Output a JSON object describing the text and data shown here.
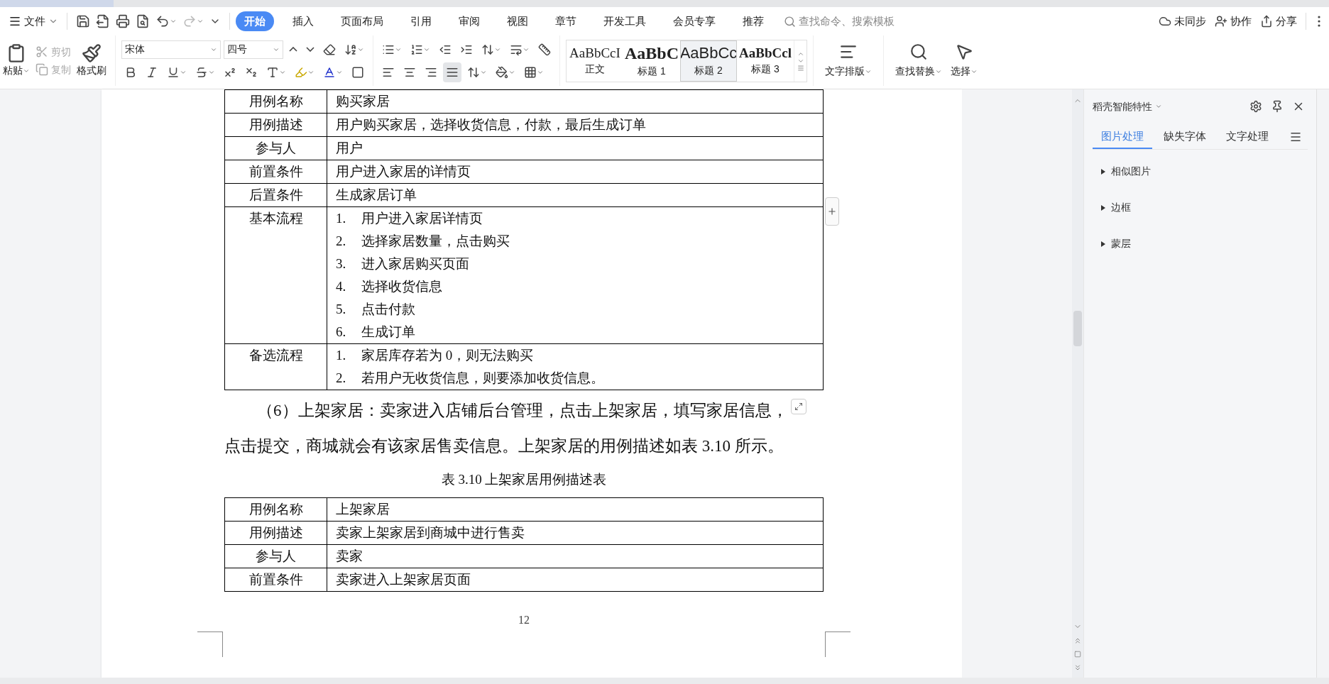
{
  "menu": {
    "file": "文件",
    "tabs": [
      {
        "label": "开始",
        "selected": true
      },
      {
        "label": "插入",
        "selected": false
      },
      {
        "label": "页面布局",
        "selected": false
      },
      {
        "label": "引用",
        "selected": false
      },
      {
        "label": "审阅",
        "selected": false
      },
      {
        "label": "视图",
        "selected": false
      },
      {
        "label": "章节",
        "selected": false
      },
      {
        "label": "开发工具",
        "selected": false
      },
      {
        "label": "会员专享",
        "selected": false
      },
      {
        "label": "推荐",
        "selected": false
      }
    ],
    "search": {
      "placeholder": "查找命令、搜索模板"
    },
    "actions": [
      "未同步",
      "协作",
      "分享"
    ]
  },
  "ribbon": {
    "paste": "粘贴",
    "cut": {
      "label": "剪切",
      "disabled": true
    },
    "copy": {
      "label": "复制",
      "disabled": true
    },
    "format_painter": "格式刷",
    "font": {
      "name": "宋体",
      "size": "四号"
    },
    "styles": [
      {
        "preview": "AaBbCcI",
        "label": "正文",
        "selected": false,
        "kind": "body"
      },
      {
        "preview": "AaBbC",
        "label": "标题 1",
        "selected": false,
        "kind": "h1"
      },
      {
        "preview": "AaBbCc",
        "label": "标题 2",
        "selected": true,
        "kind": "h2"
      },
      {
        "preview": "AaBbCcl",
        "label": "标题 3",
        "selected": false,
        "kind": "h3"
      }
    ],
    "text_layout": "文字排版",
    "find_replace": "查找替换",
    "select": "选择"
  },
  "document": {
    "table_1": [
      {
        "label": "用例名称",
        "lines": [
          {
            "text": "购买家居"
          }
        ]
      },
      {
        "label": "用例描述",
        "lines": [
          {
            "text": "用户购买家居，选择收货信息，付款，最后生成订单"
          }
        ]
      },
      {
        "label": "参与人",
        "lines": [
          {
            "text": "用户"
          }
        ]
      },
      {
        "label": "前置条件",
        "lines": [
          {
            "text": "用户进入家居的详情页"
          }
        ]
      },
      {
        "label": "后置条件",
        "lines": [
          {
            "text": "生成家居订单"
          }
        ]
      },
      {
        "label": "基本流程",
        "lines": [
          {
            "num": "1.",
            "text": "用户进入家居详情页"
          },
          {
            "num": "2.",
            "text": "选择家居数量，点击购买"
          },
          {
            "num": "3.",
            "text": "进入家居购买页面"
          },
          {
            "num": "4.",
            "text": "选择收货信息"
          },
          {
            "num": "5.",
            "text": "点击付款"
          },
          {
            "num": "6.",
            "text": "生成订单"
          }
        ]
      },
      {
        "label": "备选流程",
        "lines": [
          {
            "num": "1.",
            "text": "家居库存若为 0，则无法购买"
          },
          {
            "num": "2.",
            "text": "若用户无收货信息，则要添加收货信息。"
          }
        ]
      }
    ],
    "paragraph": [
      "（6）上架家居：卖家进入店铺后台管理，点击上架家居，填写家居信息，",
      "点击提交，商城就会有该家居售卖信息。上架家居的用例描述如表 3.10 所示。"
    ],
    "caption": "表 3.10  上架家居用例描述表",
    "table_2": [
      {
        "label": "用例名称",
        "lines": [
          {
            "text": "上架家居"
          }
        ]
      },
      {
        "label": "用例描述",
        "lines": [
          {
            "text": "卖家上架家居到商城中进行售卖"
          }
        ]
      },
      {
        "label": "参与人",
        "lines": [
          {
            "text": "卖家"
          }
        ]
      },
      {
        "label": "前置条件",
        "lines": [
          {
            "text": "卖家进入上架家居页面"
          }
        ]
      }
    ],
    "page_number": "12"
  },
  "side_panel": {
    "title": "稻壳智能特性",
    "tabs": [
      {
        "label": "图片处理",
        "selected": true
      },
      {
        "label": "缺失字体",
        "selected": false
      },
      {
        "label": "文字处理",
        "selected": false
      }
    ],
    "sections": [
      {
        "label": "相似图片",
        "expanded": false
      },
      {
        "label": "边框",
        "expanded": false
      },
      {
        "label": "蒙层",
        "expanded": false
      }
    ]
  }
}
